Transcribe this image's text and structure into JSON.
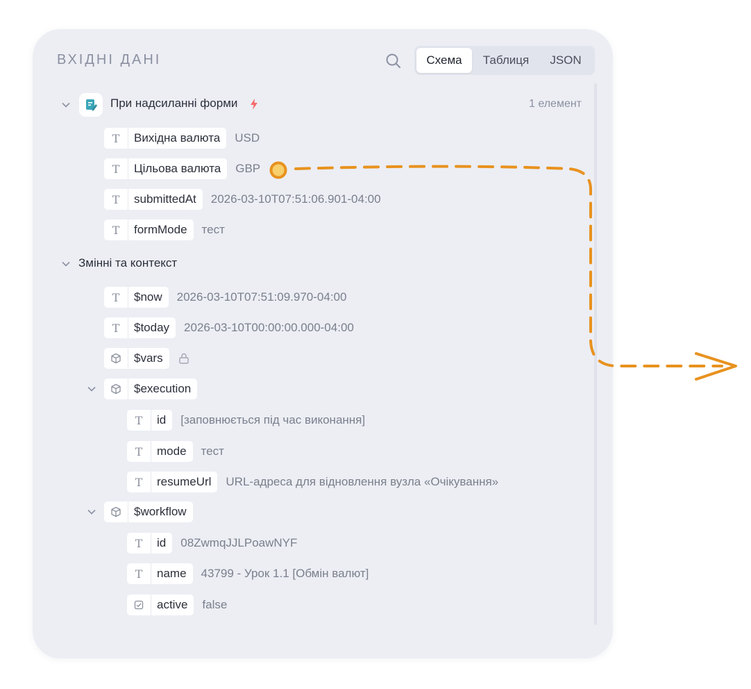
{
  "header": {
    "title": "ВХІДНІ ДАНІ"
  },
  "tabs": [
    {
      "label": "Схема",
      "active": true
    },
    {
      "label": "Таблиця",
      "active": false
    },
    {
      "label": "JSON",
      "active": false
    }
  ],
  "trigger": {
    "label": "При надсиланні форми",
    "count": "1 елемент",
    "fields": [
      {
        "type": "T",
        "name": "Вихідна валюта",
        "value": "USD"
      },
      {
        "type": "T",
        "name": "Цільова валюта",
        "value": "GBP"
      },
      {
        "type": "T",
        "name": "submittedAt",
        "value": "2026-03-10T07:51:06.901-04:00"
      },
      {
        "type": "T",
        "name": "formMode",
        "value": "тест"
      }
    ]
  },
  "context": {
    "label": "Змінні та контекст",
    "fields": [
      {
        "type": "T",
        "name": "$now",
        "value": "2026-03-10T07:51:09.970-04:00"
      },
      {
        "type": "T",
        "name": "$today",
        "value": "2026-03-10T00:00:00.000-04:00"
      },
      {
        "type": "object",
        "name": "$vars"
      }
    ],
    "execution": {
      "name": "$execution",
      "fields": [
        {
          "type": "T",
          "name": "id",
          "value": "[заповнюється під час виконання]"
        },
        {
          "type": "T",
          "name": "mode",
          "value": "тест"
        },
        {
          "type": "T",
          "name": "resumeUrl",
          "value": "URL-адреса для відновлення вузла «Очікування»"
        }
      ]
    },
    "workflow": {
      "name": "$workflow",
      "fields": [
        {
          "type": "T",
          "name": "id",
          "value": "08ZwmqJJLPoawNYF"
        },
        {
          "type": "T",
          "name": "name",
          "value": "43799 - Урок 1.1 [Обмін валют]"
        },
        {
          "type": "bool",
          "name": "active",
          "value": "false"
        }
      ]
    }
  },
  "colors": {
    "accent_orange": "#e8921f",
    "panel_bg": "#eceef4",
    "bolt": "#f26b6b"
  }
}
